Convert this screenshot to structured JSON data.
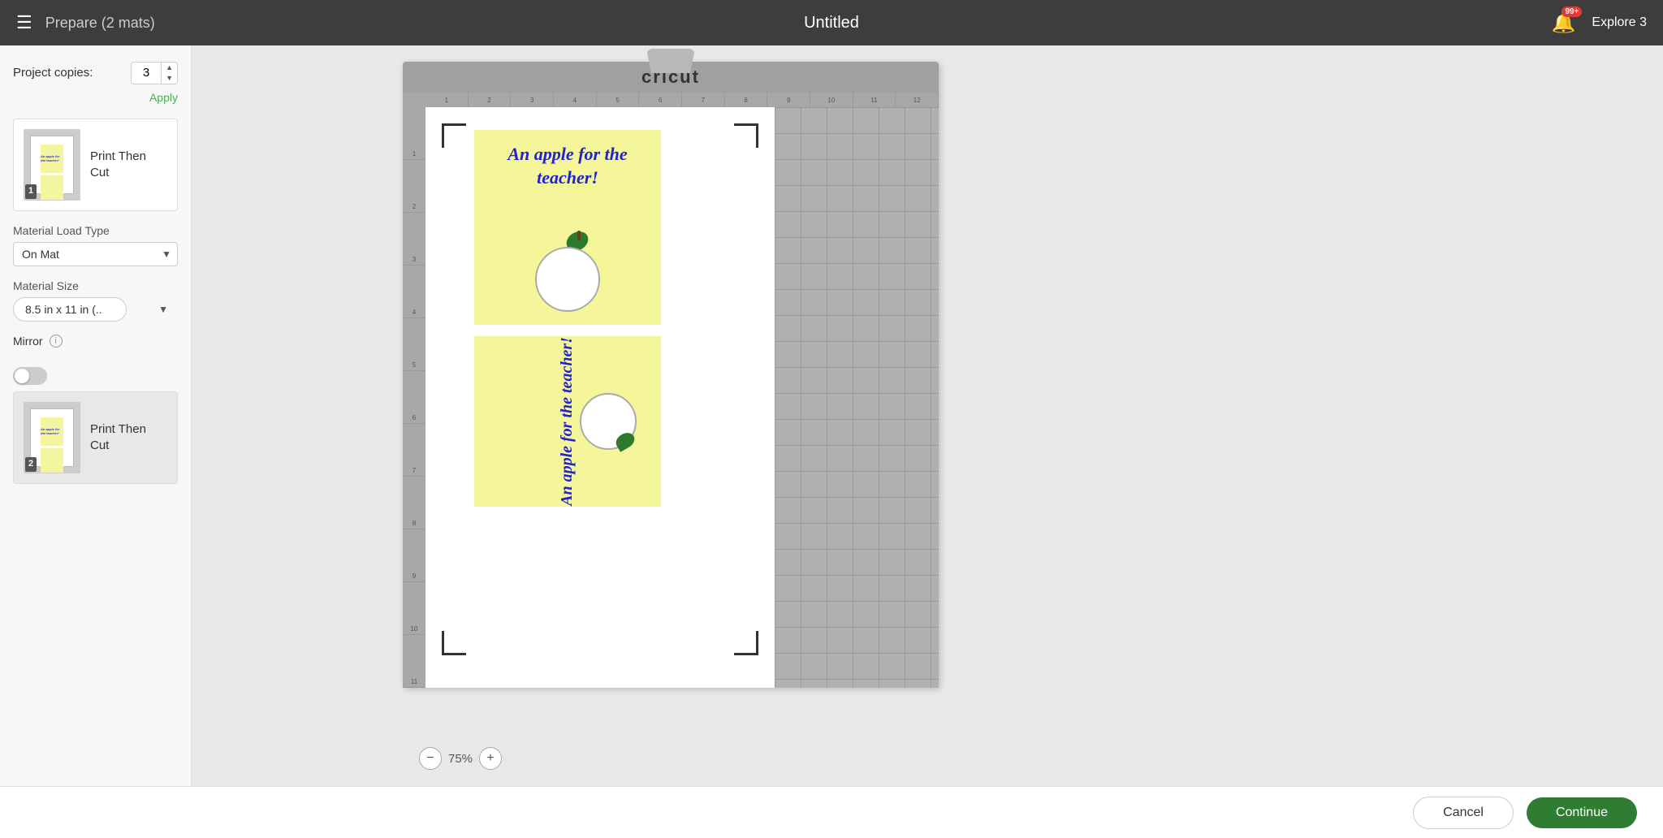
{
  "topbar": {
    "menu_icon": "≡",
    "title": "Prepare (2 mats)",
    "center_title": "Untitled",
    "notification_badge": "99+",
    "explore_label": "Explore 3"
  },
  "sidebar": {
    "project_copies_label": "Project copies:",
    "copies_value": "3",
    "apply_label": "Apply",
    "mat1": {
      "number": "1",
      "label": "Print Then Cut"
    },
    "material_load_type_label": "Material Load Type",
    "material_load_value": "On Mat",
    "material_size_label": "Material Size",
    "material_size_value": "8.5 in x 11 in (...",
    "mirror_label": "Mirror",
    "mat2": {
      "number": "2",
      "label": "Print Then Cut"
    }
  },
  "canvas": {
    "zoom_level": "75%",
    "zoom_minus": "−",
    "zoom_plus": "+"
  },
  "bottom": {
    "cancel_label": "Cancel",
    "continue_label": "Continue"
  },
  "mat": {
    "brand": "cricut",
    "ruler_cols": [
      "1",
      "2",
      "3",
      "4",
      "5",
      "6",
      "7",
      "8",
      "9",
      "10",
      "11",
      "12"
    ],
    "ruler_rows": [
      "1",
      "2",
      "3",
      "4",
      "5",
      "6",
      "7",
      "8",
      "9",
      "10",
      "11"
    ],
    "card1_text": "An apple for the teacher!",
    "card2_text": "An apple for the teacher!"
  }
}
